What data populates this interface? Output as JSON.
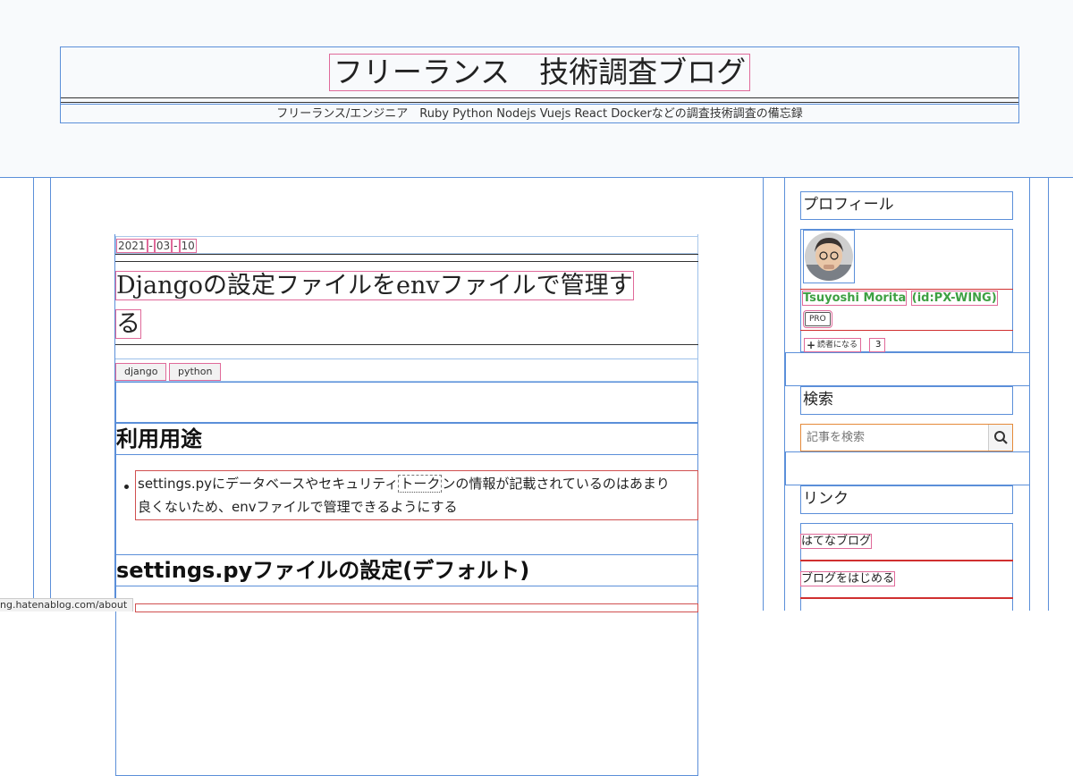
{
  "blog": {
    "title": "フリーランス　技術調査ブログ",
    "description": "フリーランス/エンジニア　Ruby Python Nodejs Vuejs React Dockerなどの調査技術調査の備忘録"
  },
  "article": {
    "date": {
      "year": "2021",
      "month": "03",
      "day": "10"
    },
    "title_line1": "Djangoの設定ファイルをenvファイルで管理す",
    "title_line2": "る",
    "categories": [
      "django",
      "python"
    ],
    "section1": {
      "heading": "利用用途",
      "bullet_before": "settings.pyにデータベースやセキュリティ",
      "bullet_token": "トーク",
      "bullet_after": "ンの情報が記載されているのはあまり",
      "bullet_line2": "良くないため、envファイルで管理できるようにする"
    },
    "section2": {
      "heading": "settings.pyファイルの設定(デフォルト)"
    }
  },
  "sidebar": {
    "profile": {
      "title": "プロフィール",
      "name": "Tsuyoshi Morita",
      "id": "(id:PX-WING)",
      "badge": "PRO",
      "reader_button": "読者になる",
      "reader_count": "3"
    },
    "search": {
      "title": "検索",
      "placeholder": "記事を検索"
    },
    "links": {
      "title": "リンク",
      "items": [
        "はてなブログ",
        "ブログをはじめる"
      ]
    }
  },
  "status_bar": {
    "url": "ng.hatenablog.com/about"
  },
  "colors": {
    "accent_green": "#3ea043",
    "outline_blue": "#5b8fd9",
    "outline_pink": "#e06a9a"
  }
}
